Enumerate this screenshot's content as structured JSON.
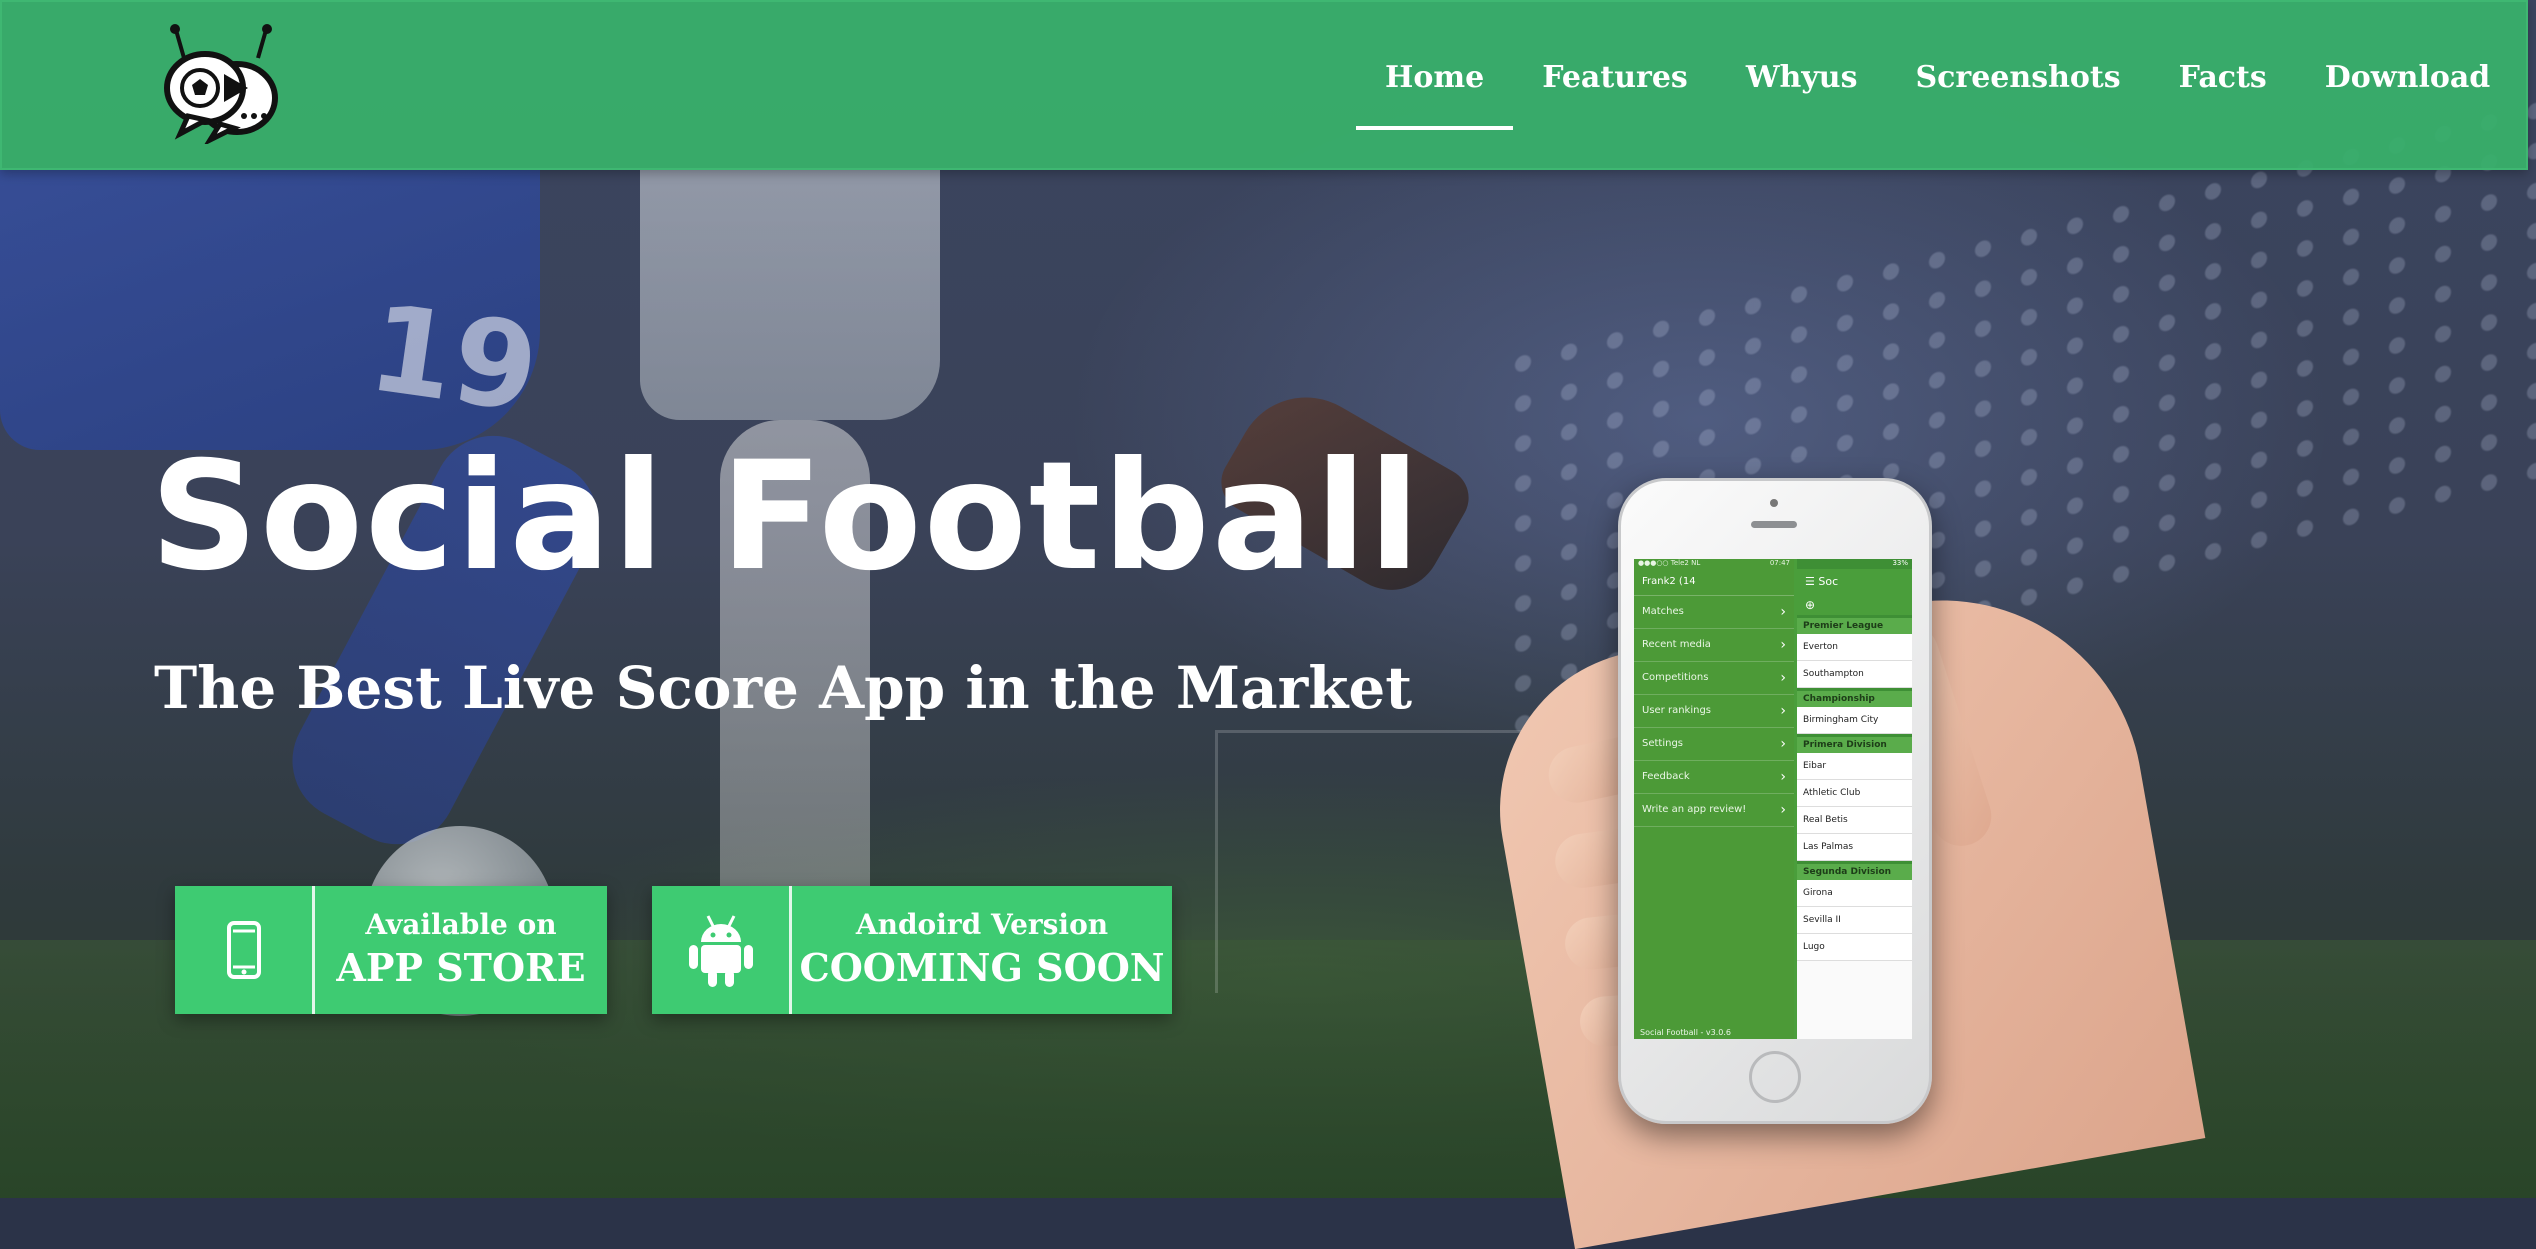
{
  "nav": {
    "logo_icon": "football-chat-bubbles-logo",
    "items": [
      {
        "label": "Home",
        "active": true
      },
      {
        "label": "Features",
        "active": false
      },
      {
        "label": "Whyus",
        "active": false
      },
      {
        "label": "Screenshots",
        "active": false
      },
      {
        "label": "Facts",
        "active": false
      },
      {
        "label": "Download",
        "active": false
      }
    ]
  },
  "hero": {
    "title": "Social Football",
    "subtitle": "The Best Live Score App in the Market"
  },
  "cta": {
    "appstore": {
      "icon": "mobile-phone-icon",
      "small": "Available on",
      "big": "APP STORE"
    },
    "android": {
      "icon": "android-icon",
      "small": "Andoird Version",
      "big": "COOMING SOON"
    }
  },
  "phone_screen": {
    "status_left": "●●●○○ Tele2 NL",
    "status_time": "07:47",
    "status_right": "33%",
    "user": "Frank2 (14",
    "menu_items": [
      "Matches",
      "Recent media",
      "Competitions",
      "User rankings",
      "Settings",
      "Feedback",
      "Write an app review!"
    ],
    "footer": "Social Football - v3.0.6",
    "list_header": "Soc",
    "leagues": [
      {
        "name": "Premier League",
        "teams": [
          "Everton",
          "Southampton"
        ]
      },
      {
        "name": "Championship",
        "teams": [
          "Birmingham City"
        ]
      },
      {
        "name": "Primera Division",
        "teams": [
          "Eibar",
          "Athletic Club",
          "Real Betis",
          "Las Palmas"
        ]
      },
      {
        "name": "Segunda Division",
        "teams": [
          "Girona",
          "Sevilla II",
          "Lugo"
        ]
      }
    ]
  },
  "colors": {
    "nav_green": "#38b26a",
    "button_green": "#3ecb72",
    "app_green": "#4a9e3b"
  }
}
